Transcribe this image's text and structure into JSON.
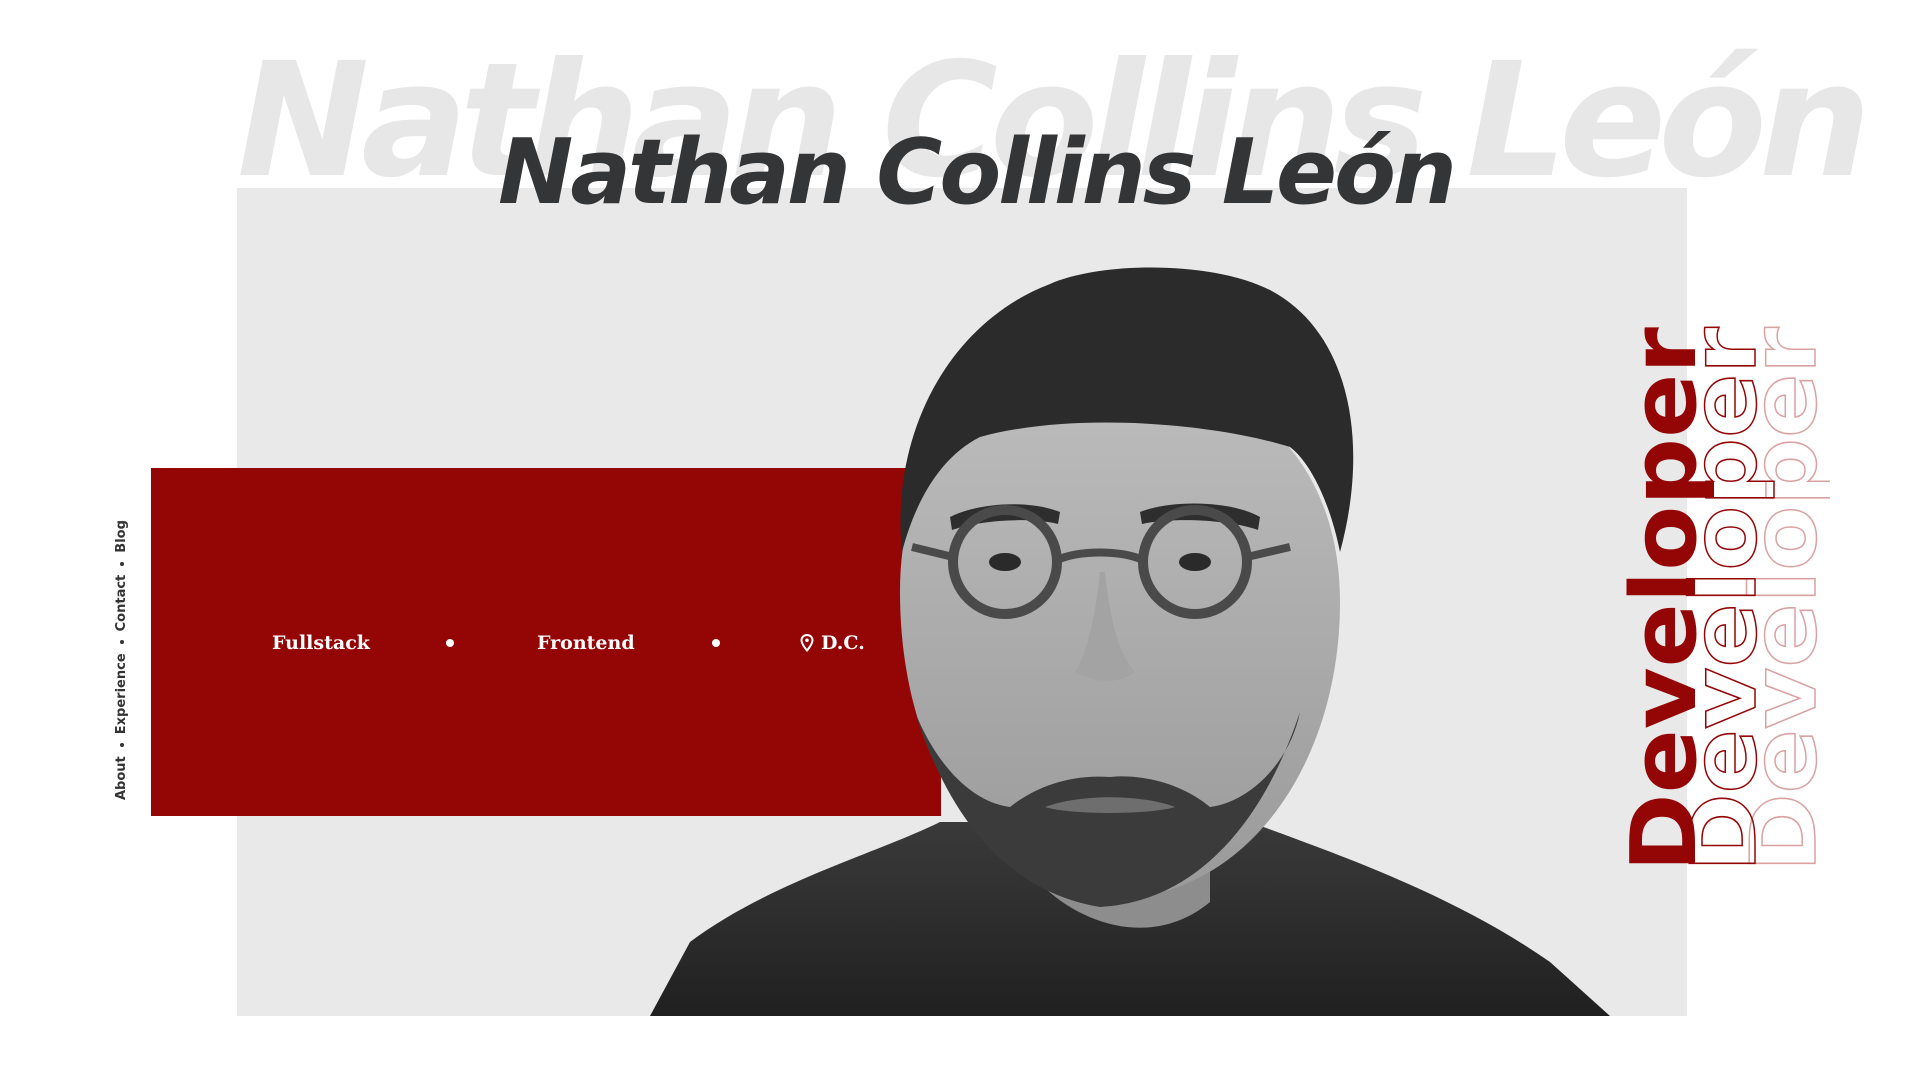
{
  "hero": {
    "ghost_name": "Nathan Collins León",
    "name": "Nathan Collins León"
  },
  "nav": {
    "items": [
      "About",
      "Experience",
      "Contact",
      "Blog"
    ]
  },
  "tags": {
    "first": "Fullstack",
    "second": "Frontend",
    "location": "D.C."
  },
  "role": {
    "word": "Developer",
    "repeat_count": 3
  },
  "colors": {
    "accent_red": "#940506",
    "panel_gray": "#e9e9ea",
    "title_dark": "#343536",
    "ghost_gray": "#e7e7e8"
  },
  "icons": {
    "location": "map-pin-icon"
  }
}
